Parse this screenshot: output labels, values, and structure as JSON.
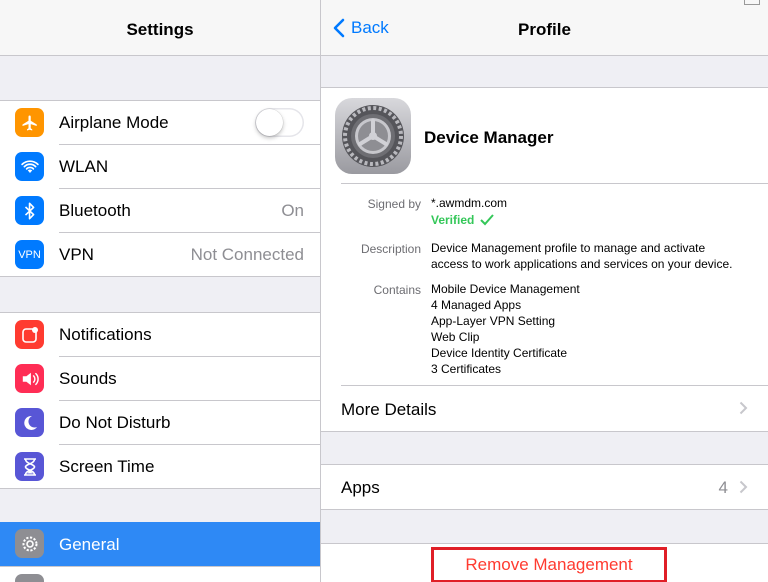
{
  "left": {
    "title": "Settings",
    "group1": [
      {
        "label": "Airplane Mode",
        "icon": "airplane-icon",
        "color": "#ff9500",
        "toggle": false
      },
      {
        "label": "WLAN",
        "icon": "wifi-icon",
        "color": "#007aff"
      },
      {
        "label": "Bluetooth",
        "icon": "bluetooth-icon",
        "color": "#007aff",
        "value": "On"
      },
      {
        "label": "VPN",
        "icon": "vpn-icon",
        "color": "#007aff",
        "value": "Not Connected",
        "badge": "VPN"
      }
    ],
    "group2": [
      {
        "label": "Notifications",
        "icon": "notifications-icon",
        "color": "#ff3b30"
      },
      {
        "label": "Sounds",
        "icon": "sounds-icon",
        "color": "#ff2d55"
      },
      {
        "label": "Do Not Disturb",
        "icon": "moon-icon",
        "color": "#5856d6"
      },
      {
        "label": "Screen Time",
        "icon": "hourglass-icon",
        "color": "#5856d6"
      }
    ],
    "selected": {
      "label": "General",
      "icon": "gear-icon"
    }
  },
  "right": {
    "back_label": "Back",
    "title": "Profile",
    "profile": {
      "name": "Device Manager",
      "signed_by_label": "Signed by",
      "signed_by": "*.awmdm.com",
      "verified": "Verified",
      "description_label": "Description",
      "description_1": "Device Management profile to manage and activate",
      "description_2": "access to work applications and services on your device.",
      "contains_label": "Contains",
      "contains": [
        "Mobile Device Management",
        "4 Managed Apps",
        "App-Layer VPN Setting",
        "Web Clip",
        "Device Identity Certificate",
        "3 Certificates"
      ],
      "more_details": "More Details"
    },
    "apps": {
      "label": "Apps",
      "count": "4"
    },
    "remove_label": "Remove Management"
  }
}
